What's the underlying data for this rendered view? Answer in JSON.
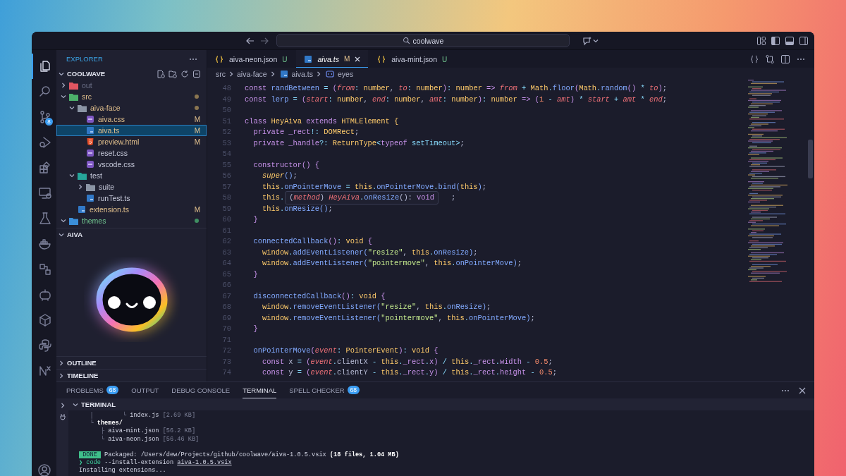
{
  "titlebar": {
    "search": {
      "value": "coolwave"
    }
  },
  "activity_bar": {
    "items": [
      {
        "kind": "files",
        "selected": true
      },
      {
        "kind": "search",
        "selected": false
      },
      {
        "kind": "scm",
        "selected": false,
        "badge": "8"
      },
      {
        "kind": "debug",
        "selected": false
      },
      {
        "kind": "extensions",
        "selected": false
      },
      {
        "kind": "remote",
        "selected": false
      },
      {
        "kind": "testing",
        "selected": false
      },
      {
        "kind": "docker",
        "selected": false
      },
      {
        "kind": "blocks",
        "selected": false
      },
      {
        "kind": "bot",
        "selected": false
      },
      {
        "kind": "package",
        "selected": false
      },
      {
        "kind": "python",
        "selected": false
      },
      {
        "kind": "nx",
        "selected": false
      }
    ],
    "account": {
      "kind": "account"
    }
  },
  "sidebar": {
    "title": "EXPLORER",
    "root": {
      "name": "COOLWAVE",
      "expanded": true
    },
    "tree": [
      {
        "name": "out",
        "kind": "folder",
        "color": "#e05561",
        "ignored": true,
        "expanded": false,
        "selected": false
      },
      {
        "name": "src",
        "kind": "folder",
        "color": "#4caf6a",
        "modified": true,
        "expanded": true,
        "selected": false,
        "children": [
          {
            "name": "aiva-face",
            "kind": "folder",
            "color": "#8b95a5",
            "modified": true,
            "expanded": true,
            "selected": false,
            "children": [
              {
                "name": "aiva.css",
                "kind": "css",
                "modified": true,
                "badge": "M",
                "selected": false
              },
              {
                "name": "aiva.ts",
                "kind": "ts",
                "modified": true,
                "badge": "M",
                "selected": true
              },
              {
                "name": "preview.html",
                "kind": "html",
                "modified": true,
                "badge": "M",
                "selected": false
              },
              {
                "name": "reset.css",
                "kind": "css",
                "selected": false
              },
              {
                "name": "vscode.css",
                "kind": "css",
                "selected": false
              }
            ]
          },
          {
            "name": "test",
            "kind": "folder",
            "color": "#26a69a",
            "expanded": true,
            "selected": false,
            "children": [
              {
                "name": "suite",
                "kind": "folder",
                "color": "#8b95a5",
                "expanded": false,
                "selected": false
              },
              {
                "name": "runTest.ts",
                "kind": "ts",
                "selected": false
              }
            ]
          },
          {
            "name": "extension.ts",
            "kind": "ts",
            "modified": true,
            "badge": "M",
            "selected": false
          }
        ]
      },
      {
        "name": "themes",
        "kind": "folder",
        "color": "#3b8ed8",
        "untracked": true,
        "expanded": true,
        "selected": false
      }
    ],
    "sections": [
      {
        "title": "AIVA",
        "expanded": true,
        "kind": "picture"
      },
      {
        "title": "OUTLINE",
        "expanded": false
      },
      {
        "title": "TIMELINE",
        "expanded": false
      }
    ]
  },
  "editor": {
    "tabs": [
      {
        "label": "aiva-neon.json",
        "kind": "json",
        "badge": "U",
        "untracked": true,
        "selected": false,
        "preview": false
      },
      {
        "label": "aiva.ts",
        "kind": "ts",
        "badge": "M",
        "modified": true,
        "selected": true,
        "preview": true
      },
      {
        "label": "aiva-mint.json",
        "kind": "json",
        "badge": "U",
        "untracked": true,
        "selected": false,
        "preview": false
      }
    ],
    "breadcrumb": [
      {
        "label": "src",
        "kind": "folder"
      },
      {
        "label": "aiva-face",
        "kind": "folder"
      },
      {
        "label": "aiva.ts",
        "kind": "ts"
      },
      {
        "label": "eyes",
        "kind": "symbol"
      }
    ],
    "lines": [
      {
        "number": "48",
        "tokens": [
          {
            "kind": "kw",
            "text": "const "
          },
          {
            "kind": "fn",
            "text": "randBetween"
          },
          {
            "kind": "op",
            "text": " = "
          },
          {
            "kind": "punc",
            "text": "("
          },
          {
            "kind": "param",
            "text": "from"
          },
          {
            "kind": "op",
            "text": ": "
          },
          {
            "kind": "ty",
            "text": "number"
          },
          {
            "kind": "plain",
            "text": ", "
          },
          {
            "kind": "param",
            "text": "to"
          },
          {
            "kind": "op",
            "text": ": "
          },
          {
            "kind": "ty",
            "text": "number"
          },
          {
            "kind": "punc",
            "text": ")"
          },
          {
            "kind": "op",
            "text": ": "
          },
          {
            "kind": "ty",
            "text": "number"
          },
          {
            "kind": "kw",
            "text": " => "
          },
          {
            "kind": "param",
            "text": "from"
          },
          {
            "kind": "op",
            "text": " + "
          },
          {
            "kind": "ty",
            "text": "Math"
          },
          {
            "kind": "op",
            "text": "."
          },
          {
            "kind": "fn",
            "text": "floor"
          },
          {
            "kind": "punc",
            "text": "("
          },
          {
            "kind": "ty",
            "text": "Math"
          },
          {
            "kind": "op",
            "text": "."
          },
          {
            "kind": "fn",
            "text": "random"
          },
          {
            "kind": "punc",
            "text": "()"
          },
          {
            "kind": "op",
            "text": " * "
          },
          {
            "kind": "param",
            "text": "to"
          },
          {
            "kind": "punc",
            "text": ")"
          },
          {
            "kind": "plain",
            "text": ";"
          }
        ]
      },
      {
        "number": "49",
        "tokens": [
          {
            "kind": "kw",
            "text": "const "
          },
          {
            "kind": "fn",
            "text": "lerp"
          },
          {
            "kind": "op",
            "text": " = "
          },
          {
            "kind": "punc",
            "text": "("
          },
          {
            "kind": "param",
            "text": "start"
          },
          {
            "kind": "op",
            "text": ": "
          },
          {
            "kind": "ty",
            "text": "number"
          },
          {
            "kind": "plain",
            "text": ", "
          },
          {
            "kind": "param",
            "text": "end"
          },
          {
            "kind": "op",
            "text": ": "
          },
          {
            "kind": "ty",
            "text": "number"
          },
          {
            "kind": "plain",
            "text": ", "
          },
          {
            "kind": "param",
            "text": "amt"
          },
          {
            "kind": "op",
            "text": ": "
          },
          {
            "kind": "ty",
            "text": "number"
          },
          {
            "kind": "punc",
            "text": ")"
          },
          {
            "kind": "op",
            "text": ": "
          },
          {
            "kind": "ty",
            "text": "number"
          },
          {
            "kind": "kw",
            "text": " => "
          },
          {
            "kind": "punc",
            "text": "("
          },
          {
            "kind": "num",
            "text": "1"
          },
          {
            "kind": "op",
            "text": " - "
          },
          {
            "kind": "param",
            "text": "amt"
          },
          {
            "kind": "punc",
            "text": ")"
          },
          {
            "kind": "op",
            "text": " * "
          },
          {
            "kind": "param",
            "text": "start"
          },
          {
            "kind": "op",
            "text": " + "
          },
          {
            "kind": "param",
            "text": "amt"
          },
          {
            "kind": "op",
            "text": " * "
          },
          {
            "kind": "param",
            "text": "end"
          },
          {
            "kind": "plain",
            "text": ";"
          }
        ]
      },
      {
        "number": "50"
      },
      {
        "number": "51",
        "tokens": [
          {
            "kind": "kw",
            "text": "class "
          },
          {
            "kind": "ty",
            "text": "HeyAiva"
          },
          {
            "kind": "kw",
            "text": " extends "
          },
          {
            "kind": "ty",
            "text": "HTMLElement"
          },
          {
            "kind": "ty",
            "text": " {"
          }
        ]
      },
      {
        "number": "52",
        "tokens": [
          {
            "kind": "kw",
            "text": "  private "
          },
          {
            "kind": "prop",
            "text": "_rect"
          },
          {
            "kind": "op",
            "text": "!: "
          },
          {
            "kind": "ty",
            "text": "DOMRect"
          },
          {
            "kind": "plain",
            "text": ";"
          }
        ]
      },
      {
        "number": "53",
        "tokens": [
          {
            "kind": "kw",
            "text": "  private "
          },
          {
            "kind": "prop",
            "text": "_handle"
          },
          {
            "kind": "op",
            "text": "?: "
          },
          {
            "kind": "ty",
            "text": "ReturnType"
          },
          {
            "kind": "op",
            "text": "<"
          },
          {
            "kind": "kw",
            "text": "typeof "
          },
          {
            "kind": "fn2",
            "text": "setTimeout"
          },
          {
            "kind": "op",
            "text": ">"
          },
          {
            "kind": "plain",
            "text": ";"
          }
        ]
      },
      {
        "number": "54"
      },
      {
        "number": "55",
        "tokens": [
          {
            "kind": "kw",
            "text": "  constructor"
          },
          {
            "kind": "punc",
            "text": "() {"
          }
        ]
      },
      {
        "number": "56",
        "tokens": [
          {
            "kind": "super",
            "text": "    super"
          },
          {
            "kind": "fn",
            "text": "()"
          },
          {
            "kind": "plain",
            "text": ";"
          }
        ]
      },
      {
        "number": "57",
        "tokens": [
          {
            "kind": "this",
            "text": "    this"
          },
          {
            "kind": "op",
            "text": "."
          },
          {
            "kind": "fn",
            "text": "onPointerMove"
          },
          {
            "kind": "op",
            "text": " = "
          },
          {
            "kind": "this",
            "text": "this"
          },
          {
            "kind": "op",
            "text": "."
          },
          {
            "kind": "fn",
            "text": "onPointerMove"
          },
          {
            "kind": "op",
            "text": "."
          },
          {
            "kind": "fn",
            "text": "bind"
          },
          {
            "kind": "fn",
            "text": "("
          },
          {
            "kind": "this",
            "text": "this"
          },
          {
            "kind": "fn",
            "text": ")"
          },
          {
            "kind": "plain",
            "text": ";"
          }
        ]
      },
      {
        "number": "58",
        "tokens": [
          {
            "kind": "this",
            "text": "    this"
          },
          {
            "kind": "op",
            "text": "."
          },
          {
            "kind": "plain",
            "text": "                                      ;"
          }
        ],
        "hover": [
          {
            "kind": "plain",
            "text": "("
          },
          {
            "kind": "param",
            "text": "method"
          },
          {
            "kind": "plain",
            "text": ") "
          },
          {
            "kind": "param",
            "text": "HeyAiva"
          },
          {
            "kind": "op",
            "text": "."
          },
          {
            "kind": "fn",
            "text": "onResize"
          },
          {
            "kind": "plain",
            "text": "(): "
          },
          {
            "kind": "kw",
            "text": "void"
          }
        ]
      },
      {
        "number": "59",
        "tokens": [
          {
            "kind": "this",
            "text": "    this"
          },
          {
            "kind": "op",
            "text": "."
          },
          {
            "kind": "fn",
            "text": "onResize"
          },
          {
            "kind": "fn",
            "text": "()"
          },
          {
            "kind": "plain",
            "text": ";"
          }
        ]
      },
      {
        "number": "60",
        "tokens": [
          {
            "kind": "punc",
            "text": "  }"
          }
        ]
      },
      {
        "number": "61"
      },
      {
        "number": "62",
        "tokens": [
          {
            "kind": "fn",
            "text": "  connectedCallback"
          },
          {
            "kind": "punc",
            "text": "()"
          },
          {
            "kind": "op",
            "text": ": "
          },
          {
            "kind": "ty",
            "text": "void"
          },
          {
            "kind": "punc",
            "text": " {"
          }
        ]
      },
      {
        "number": "63",
        "tokens": [
          {
            "kind": "this",
            "text": "    window"
          },
          {
            "kind": "op",
            "text": "."
          },
          {
            "kind": "fn",
            "text": "addEventListener"
          },
          {
            "kind": "fn",
            "text": "("
          },
          {
            "kind": "str",
            "text": "\"resize\""
          },
          {
            "kind": "plain",
            "text": ", "
          },
          {
            "kind": "this",
            "text": "this"
          },
          {
            "kind": "op",
            "text": "."
          },
          {
            "kind": "fn",
            "text": "onResize"
          },
          {
            "kind": "fn",
            "text": ")"
          },
          {
            "kind": "plain",
            "text": ";"
          }
        ]
      },
      {
        "number": "64",
        "tokens": [
          {
            "kind": "this",
            "text": "    window"
          },
          {
            "kind": "op",
            "text": "."
          },
          {
            "kind": "fn",
            "text": "addEventListener"
          },
          {
            "kind": "fn",
            "text": "("
          },
          {
            "kind": "str",
            "text": "\"pointermove\""
          },
          {
            "kind": "plain",
            "text": ", "
          },
          {
            "kind": "this",
            "text": "this"
          },
          {
            "kind": "op",
            "text": "."
          },
          {
            "kind": "fn",
            "text": "onPointerMove"
          },
          {
            "kind": "fn",
            "text": ")"
          },
          {
            "kind": "plain",
            "text": ";"
          }
        ]
      },
      {
        "number": "65",
        "tokens": [
          {
            "kind": "punc",
            "text": "  }"
          }
        ]
      },
      {
        "number": "66"
      },
      {
        "number": "67",
        "tokens": [
          {
            "kind": "fn",
            "text": "  disconnectedCallback"
          },
          {
            "kind": "punc",
            "text": "()"
          },
          {
            "kind": "op",
            "text": ": "
          },
          {
            "kind": "ty",
            "text": "void"
          },
          {
            "kind": "punc",
            "text": " {"
          }
        ]
      },
      {
        "number": "68",
        "tokens": [
          {
            "kind": "this",
            "text": "    window"
          },
          {
            "kind": "op",
            "text": "."
          },
          {
            "kind": "fn",
            "text": "removeEventListener"
          },
          {
            "kind": "fn",
            "text": "("
          },
          {
            "kind": "str",
            "text": "\"resize\""
          },
          {
            "kind": "plain",
            "text": ", "
          },
          {
            "kind": "this",
            "text": "this"
          },
          {
            "kind": "op",
            "text": "."
          },
          {
            "kind": "fn",
            "text": "onResize"
          },
          {
            "kind": "fn",
            "text": ")"
          },
          {
            "kind": "plain",
            "text": ";"
          }
        ]
      },
      {
        "number": "69",
        "tokens": [
          {
            "kind": "this",
            "text": "    window"
          },
          {
            "kind": "op",
            "text": "."
          },
          {
            "kind": "fn",
            "text": "removeEventListener"
          },
          {
            "kind": "fn",
            "text": "("
          },
          {
            "kind": "str",
            "text": "\"pointermove\""
          },
          {
            "kind": "plain",
            "text": ", "
          },
          {
            "kind": "this",
            "text": "this"
          },
          {
            "kind": "op",
            "text": "."
          },
          {
            "kind": "fn",
            "text": "onPointerMove"
          },
          {
            "kind": "fn",
            "text": ")"
          },
          {
            "kind": "plain",
            "text": ";"
          }
        ]
      },
      {
        "number": "70",
        "tokens": [
          {
            "kind": "punc",
            "text": "  }"
          }
        ]
      },
      {
        "number": "71"
      },
      {
        "number": "72",
        "tokens": [
          {
            "kind": "fn",
            "text": "  onPointerMove"
          },
          {
            "kind": "punc",
            "text": "("
          },
          {
            "kind": "param",
            "text": "event"
          },
          {
            "kind": "op",
            "text": ": "
          },
          {
            "kind": "ty",
            "text": "PointerEvent"
          },
          {
            "kind": "punc",
            "text": ")"
          },
          {
            "kind": "op",
            "text": ": "
          },
          {
            "kind": "ty",
            "text": "void"
          },
          {
            "kind": "punc",
            "text": " {"
          }
        ]
      },
      {
        "number": "73",
        "tokens": [
          {
            "kind": "kw",
            "text": "    const "
          },
          {
            "kind": "plain",
            "text": "x"
          },
          {
            "kind": "op",
            "text": " = "
          },
          {
            "kind": "punc",
            "text": "("
          },
          {
            "kind": "param",
            "text": "event"
          },
          {
            "kind": "op",
            "text": "."
          },
          {
            "kind": "plain",
            "text": "clientX"
          },
          {
            "kind": "op",
            "text": " - "
          },
          {
            "kind": "this",
            "text": "this"
          },
          {
            "kind": "op",
            "text": "."
          },
          {
            "kind": "prop",
            "text": "_rect"
          },
          {
            "kind": "op",
            "text": "."
          },
          {
            "kind": "prop",
            "text": "x"
          },
          {
            "kind": "punc",
            "text": ")"
          },
          {
            "kind": "op",
            "text": " / "
          },
          {
            "kind": "this",
            "text": "this"
          },
          {
            "kind": "op",
            "text": "."
          },
          {
            "kind": "prop",
            "text": "_rect"
          },
          {
            "kind": "op",
            "text": "."
          },
          {
            "kind": "prop",
            "text": "width"
          },
          {
            "kind": "op",
            "text": " - "
          },
          {
            "kind": "num",
            "text": "0.5"
          },
          {
            "kind": "plain",
            "text": ";"
          }
        ]
      },
      {
        "number": "74",
        "tokens": [
          {
            "kind": "kw",
            "text": "    const "
          },
          {
            "kind": "plain",
            "text": "y"
          },
          {
            "kind": "op",
            "text": " = "
          },
          {
            "kind": "punc",
            "text": "("
          },
          {
            "kind": "param",
            "text": "event"
          },
          {
            "kind": "op",
            "text": "."
          },
          {
            "kind": "plain",
            "text": "clientY"
          },
          {
            "kind": "op",
            "text": " - "
          },
          {
            "kind": "this",
            "text": "this"
          },
          {
            "kind": "op",
            "text": "."
          },
          {
            "kind": "prop",
            "text": "_rect"
          },
          {
            "kind": "op",
            "text": "."
          },
          {
            "kind": "prop",
            "text": "y"
          },
          {
            "kind": "punc",
            "text": ")"
          },
          {
            "kind": "op",
            "text": " / "
          },
          {
            "kind": "this",
            "text": "this"
          },
          {
            "kind": "op",
            "text": "."
          },
          {
            "kind": "prop",
            "text": "_rect"
          },
          {
            "kind": "op",
            "text": "."
          },
          {
            "kind": "prop",
            "text": "height"
          },
          {
            "kind": "op",
            "text": " - "
          },
          {
            "kind": "num",
            "text": "0.5"
          },
          {
            "kind": "plain",
            "text": ";"
          }
        ]
      }
    ]
  },
  "panel": {
    "tabs": [
      {
        "label": "PROBLEMS",
        "count": "68",
        "selected": false
      },
      {
        "label": "OUTPUT",
        "selected": false
      },
      {
        "label": "DEBUG CONSOLE",
        "selected": false
      },
      {
        "label": "TERMINAL",
        "selected": true
      },
      {
        "label": "SPELL CHECKER",
        "count": "68",
        "selected": false
      }
    ],
    "terminal": {
      "title": "TERMINAL",
      "expanded": true,
      "lines": [
        {
          "segments": [
            {
              "kind": "dim",
              "text": "   │        └ "
            },
            {
              "kind": "plain",
              "text": "index.js"
            },
            {
              "kind": "dim",
              "text": " [2.69 KB]"
            }
          ]
        },
        {
          "segments": [
            {
              "kind": "dim",
              "text": "   └ "
            },
            {
              "kind": "bold",
              "text": "themes/"
            }
          ]
        },
        {
          "segments": [
            {
              "kind": "dim",
              "text": "      ├ "
            },
            {
              "kind": "plain",
              "text": "aiva-mint.json"
            },
            {
              "kind": "dim",
              "text": " [56.2 KB]"
            }
          ]
        },
        {
          "segments": [
            {
              "kind": "dim",
              "text": "      └ "
            },
            {
              "kind": "plain",
              "text": "aiva-neon.json"
            },
            {
              "kind": "dim",
              "text": " [56.46 KB]"
            }
          ]
        },
        {
          "kind": "blank"
        },
        {
          "segments": [
            {
              "kind": "done",
              "text": " DONE "
            },
            {
              "kind": "plain",
              "text": " Packaged: /Users/dew/Projects/github/coolwave/aiva-1.0.5.vsix "
            },
            {
              "kind": "bold",
              "text": "(18 files, 1.04 MB)"
            }
          ]
        },
        {
          "segments": [
            {
              "kind": "green",
              "text": "❯ code"
            },
            {
              "kind": "plain",
              "text": " --install-extension "
            },
            {
              "kind": "link",
              "text": "aiva-1.0.5.vsix"
            }
          ]
        },
        {
          "segments": [
            {
              "kind": "plain",
              "text": "Installing extensions..."
            }
          ]
        }
      ]
    }
  }
}
